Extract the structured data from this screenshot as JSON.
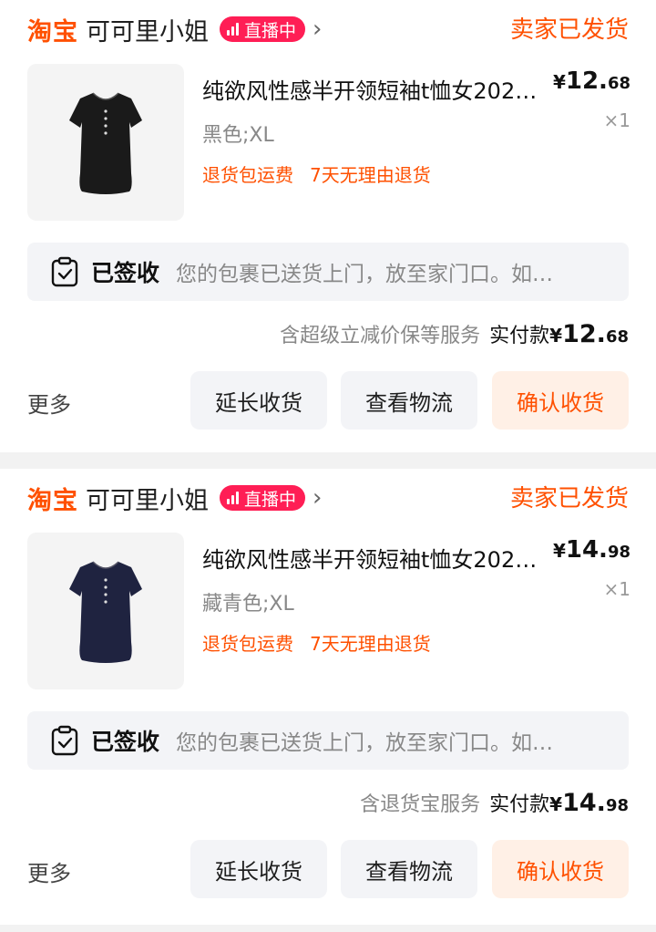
{
  "colors": {
    "brand": "#ff5000",
    "live_badge": "#ff1e55",
    "muted": "#888888",
    "panel": "#f3f4f7"
  },
  "orders": [
    {
      "platform": "淘宝",
      "store_name": "可可里小姐",
      "live_badge": "直播中",
      "status": "卖家已发货",
      "product": {
        "title": "纯欲风性感半开领短袖t恤女202…",
        "sku": "黑色;XL",
        "shirt_color": "#1a1a1a",
        "tags": [
          "退货包运费",
          "7天无理由退货"
        ],
        "price_symbol": "¥",
        "price_int": "12.",
        "price_dec": "68",
        "quantity": "×1"
      },
      "logistics": {
        "status": "已签收",
        "detail": "您的包裹已送货上门，放至家门口。如…"
      },
      "payment": {
        "service_note": "含超级立减价保等服务",
        "label": "实付款",
        "symbol": "¥",
        "int": "12.",
        "dec": "68"
      },
      "actions": {
        "more": "更多",
        "extend": "延长收货",
        "track": "查看物流",
        "confirm": "确认收货"
      }
    },
    {
      "platform": "淘宝",
      "store_name": "可可里小姐",
      "live_badge": "直播中",
      "status": "卖家已发货",
      "product": {
        "title": "纯欲风性感半开领短袖t恤女202…",
        "sku": "藏青色;XL",
        "shirt_color": "#1f2340",
        "tags": [
          "退货包运费",
          "7天无理由退货"
        ],
        "price_symbol": "¥",
        "price_int": "14.",
        "price_dec": "98",
        "quantity": "×1"
      },
      "logistics": {
        "status": "已签收",
        "detail": "您的包裹已送货上门，放至家门口。如…"
      },
      "payment": {
        "service_note": "含退货宝服务",
        "label": "实付款",
        "symbol": "¥",
        "int": "14.",
        "dec": "98"
      },
      "actions": {
        "more": "更多",
        "extend": "延长收货",
        "track": "查看物流",
        "confirm": "确认收货"
      }
    }
  ]
}
